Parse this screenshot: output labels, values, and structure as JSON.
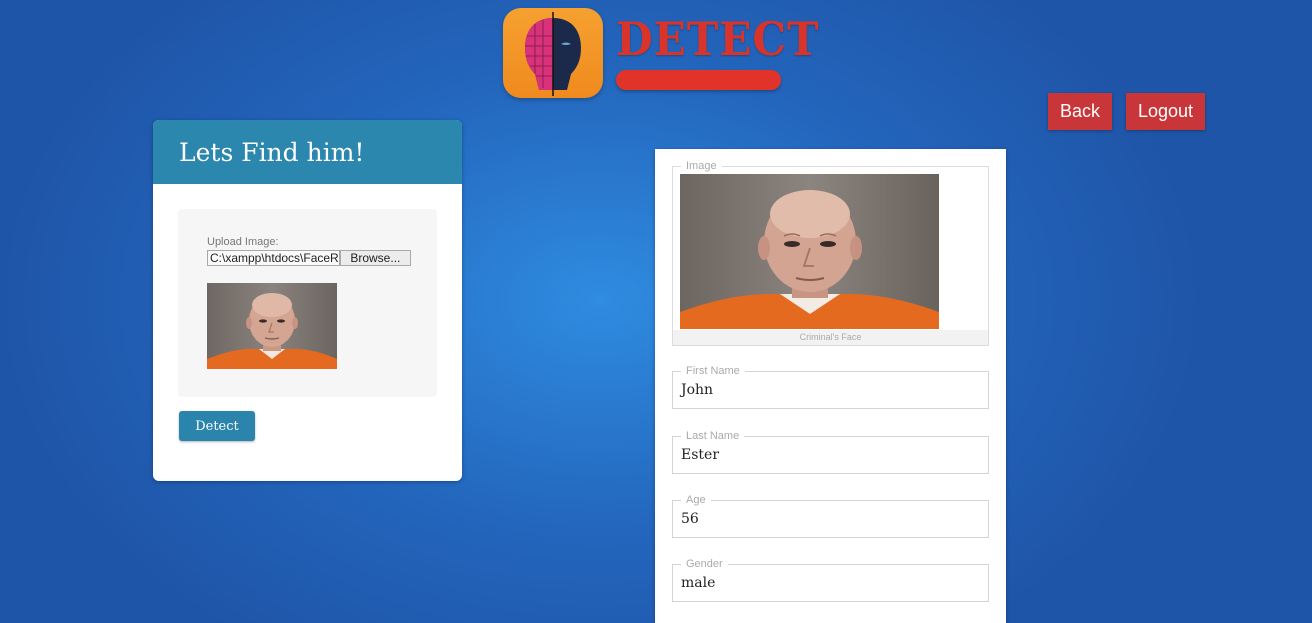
{
  "header": {
    "logo_text": "DETECT",
    "back_label": "Back",
    "logout_label": "Logout"
  },
  "left_card": {
    "title": "Lets Find him!",
    "upload_label": "Upload Image:",
    "file_path": "C:\\xampp\\htdocs\\FaceRe",
    "browse_label": "Browse...",
    "detect_label": "Detect"
  },
  "right_card": {
    "image_legend": "Image",
    "image_caption": "Criminal's Face",
    "fields": [
      {
        "legend": "First Name",
        "value": "John"
      },
      {
        "legend": "Last Name",
        "value": "Ester"
      },
      {
        "legend": "Age",
        "value": "56"
      },
      {
        "legend": "Gender",
        "value": "male"
      }
    ]
  },
  "colors": {
    "background": "#2366bd",
    "header_red": "#c8363a",
    "card_header": "#2b87ad",
    "logo_orange": "#f5a12f"
  },
  "icons": {
    "logo": "face-scan-icon",
    "photo": "mugshot-photo"
  }
}
